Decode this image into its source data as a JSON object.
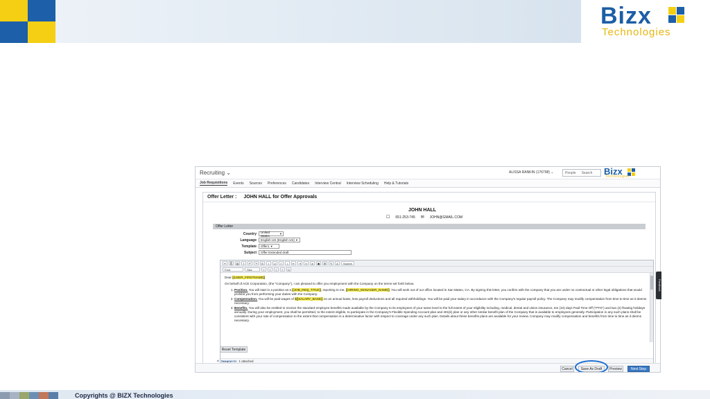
{
  "slide": {
    "logo_text": "Bizx",
    "logo_sub": "Technologies",
    "footer_text": "Copyrights @ BIZX Technologies",
    "colors": {
      "yellow": "#f4cf14",
      "blue": "#1d5fa8"
    }
  },
  "app": {
    "title": "Recruiting ⌄",
    "user": "ALISSA RANKIN (176798) ⌄",
    "search_scope": "People",
    "search_placeholder": "Search",
    "logo_text": "Bizx",
    "logo_sub": "Technologies",
    "nav": [
      "Job Requisitions",
      "Events",
      "Sources",
      "Preferences",
      "Candidates",
      "Interview Central",
      "Interview Scheduling",
      "Help & Tutorials"
    ],
    "side_tab": "Feedback"
  },
  "offer": {
    "label": "Offer Letter :",
    "title": "JOHN HALL for Offer Approvals",
    "candidate_name": "JOHN HALL",
    "phone": "651-253-745",
    "email": "JOHN@GMAIL.COM",
    "section": "Offer Letter",
    "fields": {
      "country_label": "Country",
      "country_value": "United States",
      "language_label": "Language",
      "language_value": "English US (English US)",
      "template_label": "Template",
      "template_value": "Offer1",
      "subject_label": "Subject",
      "subject_value": "Offer Extended draft"
    },
    "toolbar": {
      "font": "Font",
      "size": "Size",
      "source": "Source"
    },
    "body": {
      "greeting": "Dear",
      "greeting_token": "[[USER_FIRSTNAME]]",
      "intro": "On behalf of ACE Corporation, (the \"Company\"), I am pleased to offer you employment with the Company on the terms set forth below.",
      "item1_title": "Position.",
      "item1_a": "You will start in a position as a",
      "item1_token1": "[[JOB_REQ_TITLE]]",
      "item1_b": ", reporting to me,",
      "item1_token2": "[[HIRING_MANAGER_NAME]]",
      "item1_c": ". You will work out of our office located in San Mateo, CA.  By signing this letter, you confirm with the company that you are under no contractual or other legal obligations that would prohibit you from performing your duties with the Company.",
      "item2_title": "Compensation.",
      "item2_a": "You will be paid wages of",
      "item2_token": "$[[SALARY_BASE]]",
      "item2_b": "on an annual basis, less payroll deductions and all required withholdings.  You will be paid your salary in accordance with the Company's regular payroll policy.  The Company may modify compensation from time to time as it deems necessary.",
      "item3_title": "Benefits.",
      "item3_a": "You will also be entitled to receive the standard employee benefits made available by the Company to its employees of your same level to the full extent of your eligibility including, medical, dental and vision insurance, ten (10) days Paid Time Off (\"PTO\") and two (2) floating holidays annually.  During your employment, you shall be permitted, to the extent eligible, to participate in the Company's Flexible Spending Account plan and 401(k) plan or any other similar benefit plan of the Company that is available to employees generally. Participation in any such plans shall be consistent with your rate of compensation to the extent that compensation is a determinative factor with respect to coverage under any such plan.  Details about these benefits plans are available for your review.  Company may modify compensation and benefits from time to time as it deems necessary."
    },
    "editor_status": "body  p",
    "reset_label": "Reset Template",
    "docs_link": "Documents",
    "docs_count": "1 attached",
    "buttons": {
      "cancel": "Cancel",
      "draft": "Save As Draft",
      "preview": "Preview",
      "next": "Next Step"
    }
  }
}
